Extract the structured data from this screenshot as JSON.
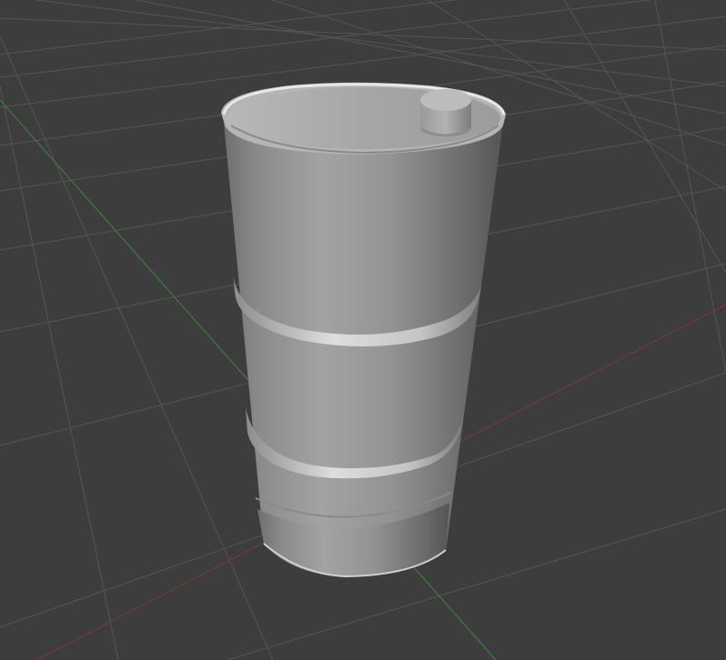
{
  "viewport": {
    "background_color": "#3d3d3d",
    "grid_color": "#5c5c5c",
    "x_axis_color": "#8a3b3b",
    "y_axis_color": "#3e7a3e"
  },
  "scene": {
    "object": "oil-drum",
    "object_color": "#9a9a9a",
    "highlight_color": "#d6d6d6"
  }
}
